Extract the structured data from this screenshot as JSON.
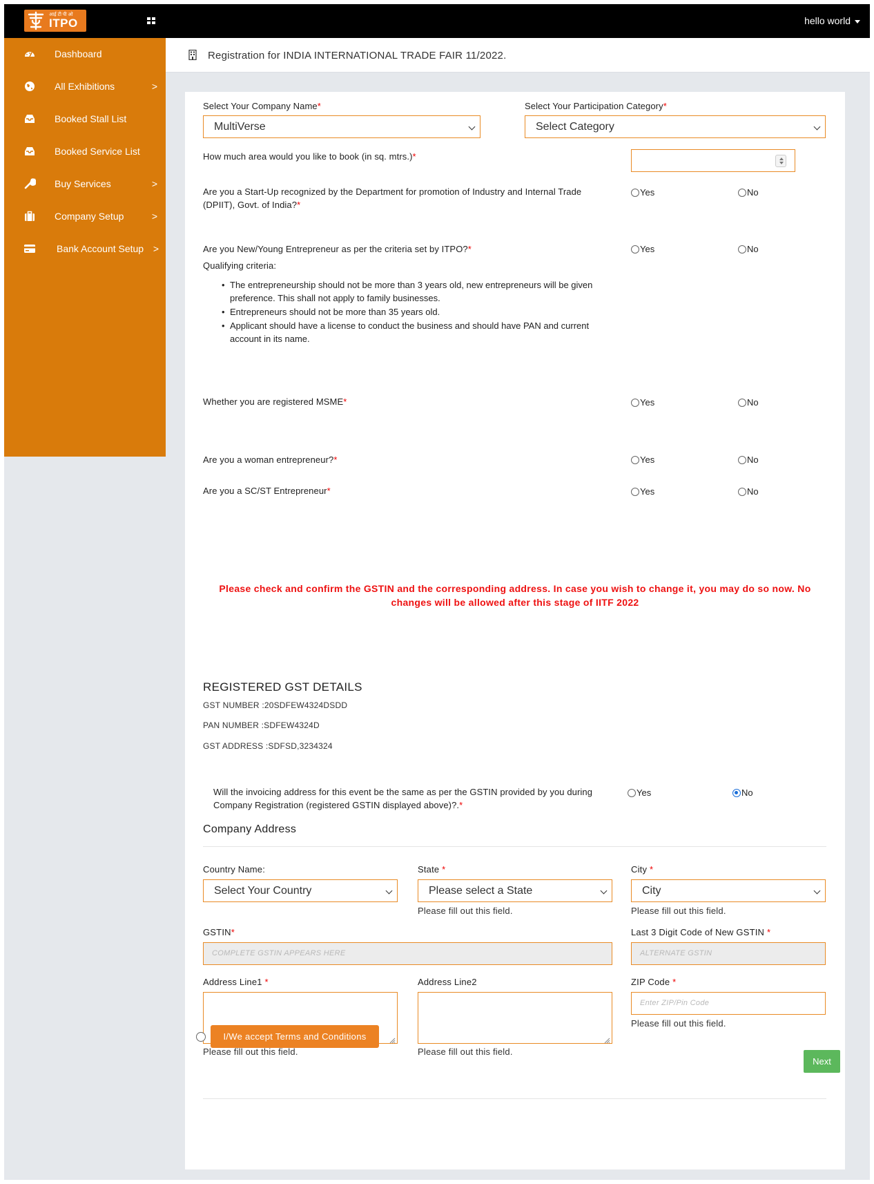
{
  "topbar": {
    "logo_hindi": "आई टी पी ओ",
    "logo_text": "ITPO",
    "user_name": "hello world"
  },
  "sidebar": {
    "items": [
      {
        "label": "Dashboard",
        "icon": "dashboard-icon",
        "has_submenu": false
      },
      {
        "label": "All Exhibitions",
        "icon": "globe-icon",
        "has_submenu": true
      },
      {
        "label": "Booked Stall List",
        "icon": "inbox-icon",
        "has_submenu": false
      },
      {
        "label": "Booked Service List",
        "icon": "inbox-icon",
        "has_submenu": false
      },
      {
        "label": "Buy Services",
        "icon": "wrench-icon",
        "has_submenu": true
      },
      {
        "label": "Company Setup",
        "icon": "briefcase-icon",
        "has_submenu": true
      },
      {
        "label": "Bank Account Setup",
        "icon": "credit-card-icon",
        "has_submenu": true
      }
    ],
    "chevron": ">"
  },
  "header": {
    "title": "Registration for INDIA INTERNATIONAL TRADE FAIR 11/2022."
  },
  "form": {
    "company_label": "Select Your Company Name",
    "company_value": "MultiVerse",
    "category_label": "Select Your Participation Category",
    "category_value": "Select Category",
    "area_label": "How much area would you like to book (in sq. mtrs.)",
    "area_value": "",
    "required_mark": "*",
    "yes_label": "Yes",
    "no_label": "No",
    "startup_question": "Are you a Start-Up recognized by the Department for promotion of Industry and Internal Trade (DPIIT), Govt. of India?",
    "entrepreneur_question": "Are you New/Young Entrepreneur as per the criteria set by ITPO?",
    "qualifying_label": "Qualifying criteria:",
    "criteria": [
      "The entrepreneurship should not be more than 3 years old, new entrepreneurs will be given preference. This shall not apply to family businesses.",
      "Entrepreneurs should not be more than 35 years old.",
      "Applicant should have a license to conduct the business and should have PAN and current account in its name."
    ],
    "msme_question": "Whether you are registered MSME",
    "woman_question": "Are you a woman entrepreneur?",
    "scst_question": "Are you a SC/ST Entrepreneur",
    "warning": "Please check and confirm the GSTIN and the corresponding address. In case you wish to change it, you may do so now. No changes will be allowed after this stage of IITF 2022",
    "gst_title": "REGISTERED GST DETAILS",
    "gst_number": "GST NUMBER :20SDFEW4324DSDD",
    "pan_number": "PAN NUMBER :SDFEW4324D",
    "gst_address": "GST ADDRESS :SDFSD,3234324",
    "invoicing_question": "Will the invoicing address for this event be the same as per the GSTIN provided by you during Company Registration (registered GSTIN displayed above)?.",
    "invoicing_selected": "No",
    "address_title": "Company Address",
    "country_label": "Country Name:",
    "country_value": "Select Your Country",
    "state_label": "State",
    "state_value": "Please select a State",
    "city_label": "City",
    "city_value": "City",
    "fill_hint": "Please fill out this field.",
    "gstin_label": "GSTIN",
    "gstin_placeholder": "COMPLETE GSTIN APPEARS HERE",
    "last3_label": "Last 3 Digit Code of New GSTIN",
    "last3_placeholder": "ALTERNATE GSTIN",
    "addr1_label": "Address Line1",
    "addr2_label": "Address Line2",
    "zip_label": "ZIP Code",
    "zip_placeholder": "Enter ZIP/Pin Code",
    "terms_label": "I/We accept Terms and Conditions",
    "next_label": "Next"
  },
  "colors": {
    "sidebar": "#d97b0b",
    "accent": "#e98a24",
    "warning": "#ee1111",
    "next": "#5cb85c",
    "radio_selected": "#1a6ed8"
  }
}
